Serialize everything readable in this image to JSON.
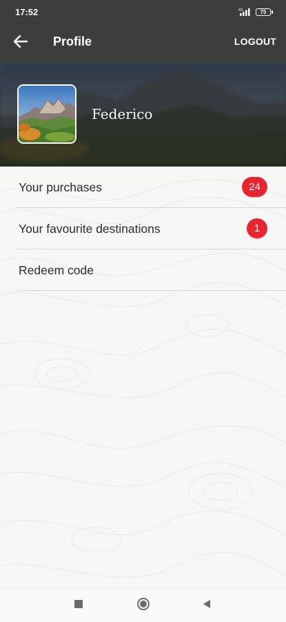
{
  "status_bar": {
    "time": "17:52",
    "battery_level": "75",
    "icons": [
      "signal-icon",
      "battery-icon"
    ]
  },
  "app_bar": {
    "title": "Profile",
    "logout_label": "LOGOUT",
    "back_icon": "arrow-left-icon"
  },
  "profile": {
    "user_name": "Federico",
    "avatar_icon": "mountain-landscape-avatar"
  },
  "menu": {
    "items": [
      {
        "label": "Your purchases",
        "badge": "24"
      },
      {
        "label": "Your favourite destinations",
        "badge": "1"
      },
      {
        "label": "Redeem code",
        "badge": null
      }
    ]
  },
  "nav_bar": {
    "icons": [
      "recents-square-icon",
      "home-circle-icon",
      "back-triangle-icon"
    ]
  },
  "colors": {
    "app_bar": "#3d3d3c",
    "badge": "#e7242f",
    "divider": "#d3d3d3",
    "text": "#2b2b2b"
  }
}
